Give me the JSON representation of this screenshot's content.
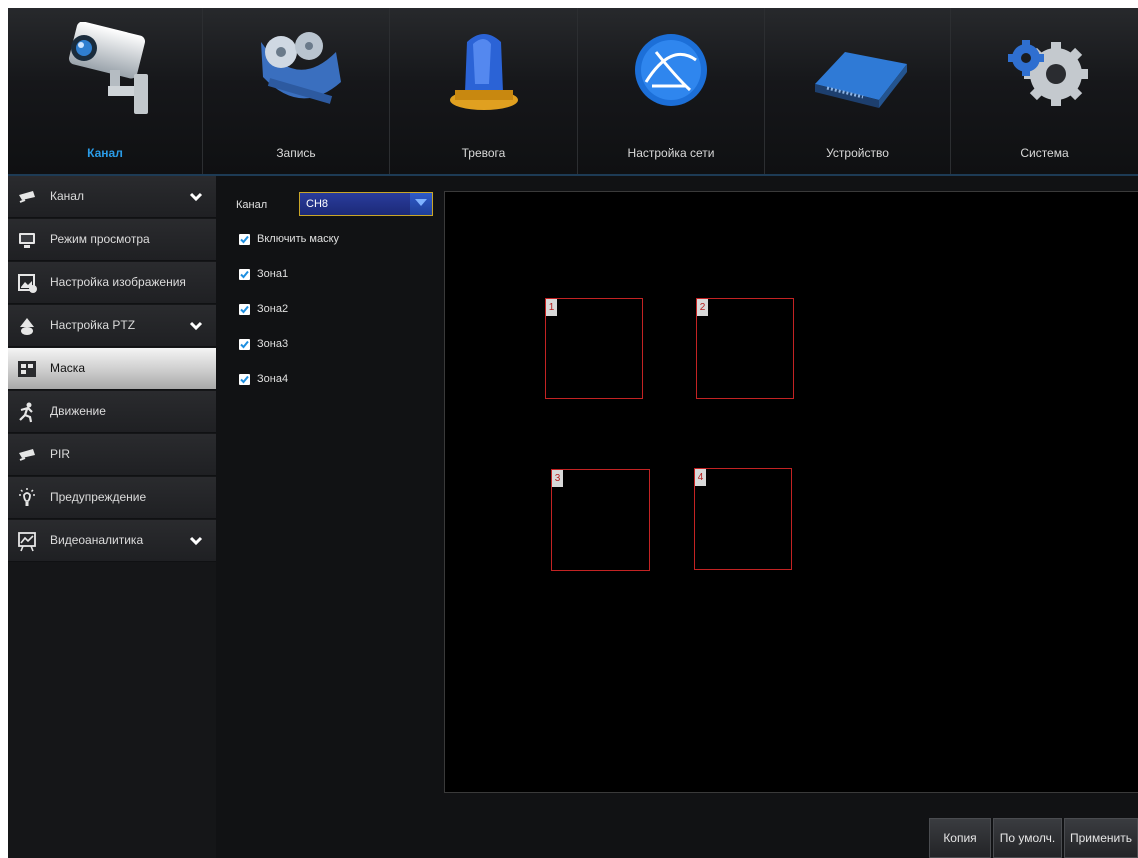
{
  "topnav": {
    "tabs": [
      {
        "label": "Канал",
        "icon": "camera-icon",
        "active": true
      },
      {
        "label": "Запись",
        "icon": "film-reel-icon",
        "active": false
      },
      {
        "label": "Тревога",
        "icon": "siren-icon",
        "active": false
      },
      {
        "label": "Настройка сети",
        "icon": "globe-icon",
        "active": false
      },
      {
        "label": "Устройство",
        "icon": "hard-drive-icon",
        "active": false
      },
      {
        "label": "Система",
        "icon": "gears-icon",
        "active": false
      }
    ]
  },
  "sidebar": {
    "items": [
      {
        "label": "Канал",
        "icon": "camera-icon",
        "expandable": true
      },
      {
        "label": "Режим просмотра",
        "icon": "monitor-icon",
        "expandable": false
      },
      {
        "label": "Настройка изображения",
        "icon": "image-settings-icon",
        "expandable": false
      },
      {
        "label": "Настройка PTZ",
        "icon": "ptz-camera-icon",
        "expandable": true
      },
      {
        "label": "Маска",
        "icon": "mask-icon",
        "expandable": false,
        "active": true
      },
      {
        "label": "Движение",
        "icon": "running-person-icon",
        "expandable": false
      },
      {
        "label": "PIR",
        "icon": "camera-icon",
        "expandable": false
      },
      {
        "label": "Предупреждение",
        "icon": "lightbulb-icon",
        "expandable": false
      },
      {
        "label": "Видеоаналитика",
        "icon": "analytics-icon",
        "expandable": true
      }
    ]
  },
  "settings": {
    "channel_label": "Канал",
    "channel_value": "CH8",
    "enable_mask_label": "Включить маску",
    "enable_mask_checked": true,
    "zones": [
      {
        "label": "Зона1",
        "checked": true
      },
      {
        "label": "Зона2",
        "checked": true
      },
      {
        "label": "Зона3",
        "checked": true
      },
      {
        "label": "Зона4",
        "checked": true
      }
    ]
  },
  "preview": {
    "zone_numbers": [
      "1",
      "2",
      "3",
      "4"
    ],
    "zone_color": "#c32323"
  },
  "buttons": {
    "copy": "Копия",
    "default": "По умолч.",
    "apply": "Применить"
  },
  "colors": {
    "accent": "#2a9ce8",
    "select_border": "#c9a628",
    "checkbox_check": "#1e8fe0"
  }
}
